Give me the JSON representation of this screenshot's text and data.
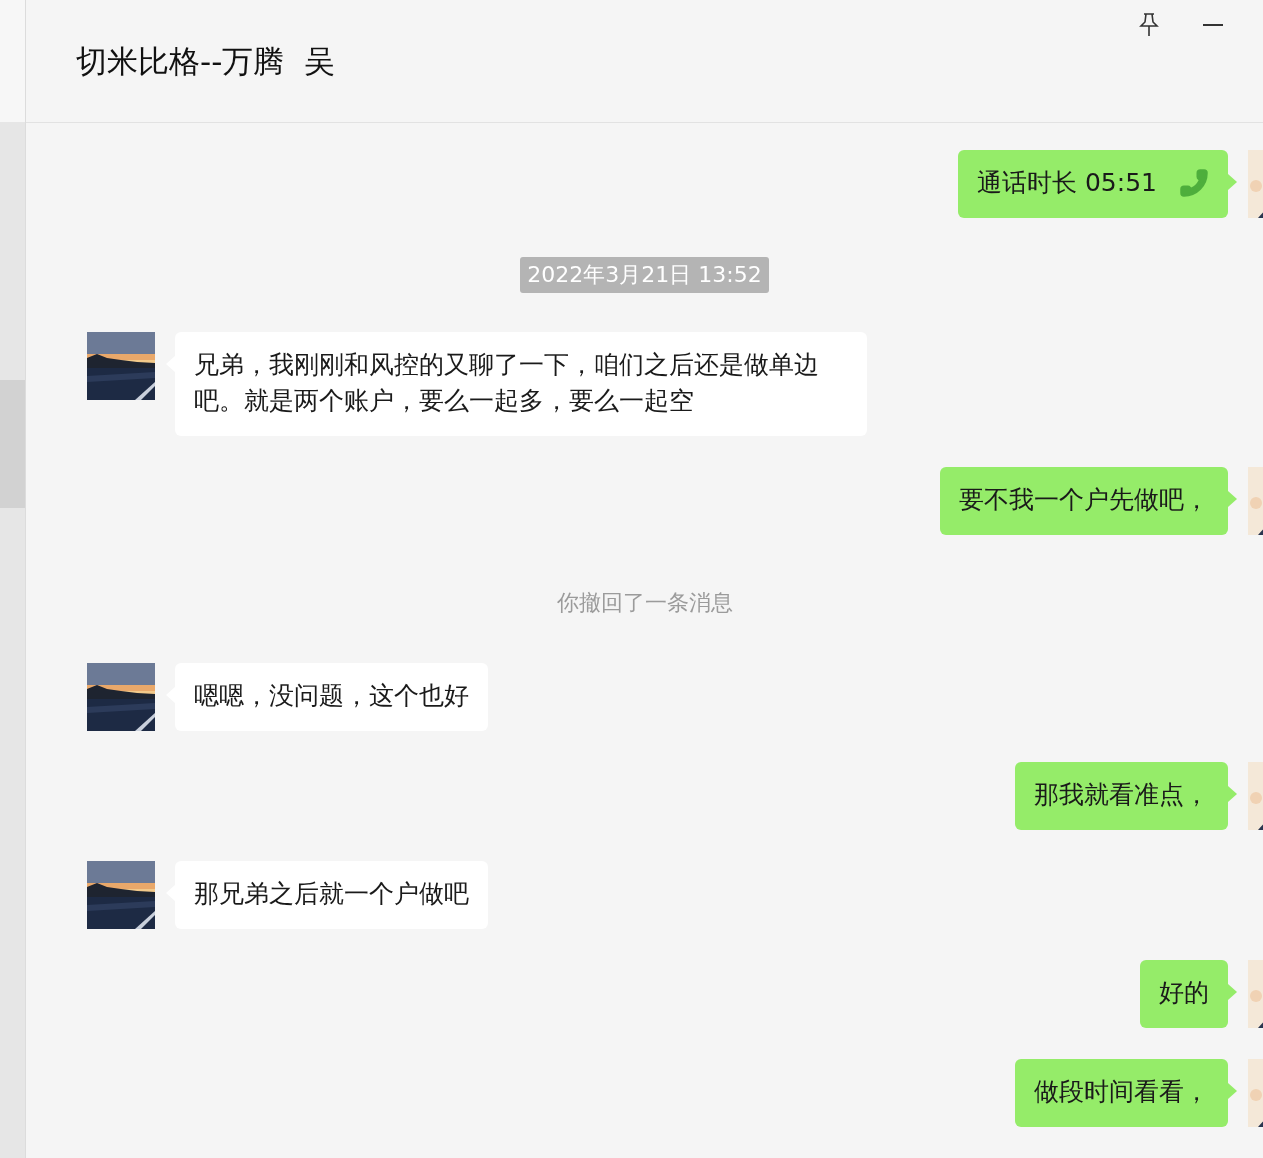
{
  "chat": {
    "title": "切米比格--万腾  吴"
  },
  "messages": [
    {
      "kind": "call",
      "text": "通话时长 05:51"
    },
    {
      "kind": "time",
      "text": "2022年3月21日 13:52"
    },
    {
      "kind": "incoming",
      "text": "兄弟，我刚刚和风控的又聊了一下，咱们之后还是做单边吧。就是两个账户，要么一起多，要么一起空"
    },
    {
      "kind": "outgoing",
      "text": "要不我一个户先做吧，"
    },
    {
      "kind": "system",
      "text": "你撤回了一条消息"
    },
    {
      "kind": "incoming",
      "text": "嗯嗯，没问题，这个也好"
    },
    {
      "kind": "outgoing",
      "text": "那我就看准点，"
    },
    {
      "kind": "incoming",
      "text": "那兄弟之后就一个户做吧"
    },
    {
      "kind": "outgoing",
      "text": "好的"
    },
    {
      "kind": "outgoing",
      "text": "做段时间看看，"
    }
  ]
}
